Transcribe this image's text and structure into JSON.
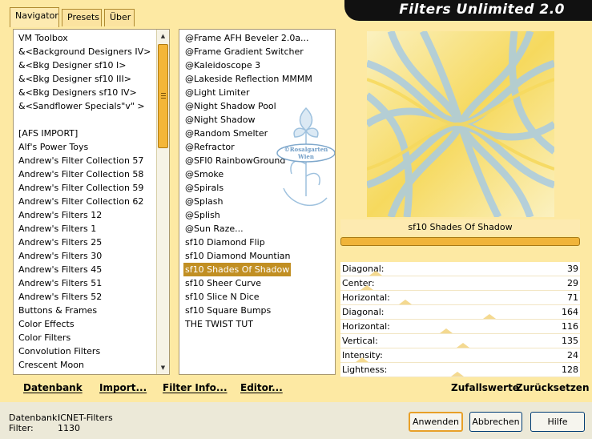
{
  "app_title": "Filters Unlimited 2.0",
  "tabs": [
    "Navigator",
    "Presets",
    "Über"
  ],
  "categories": {
    "selected_index": 1,
    "items": [
      "VM Toolbox",
      "&<Background Designers IV>",
      "&<Bkg Designer sf10 I>",
      "&<Bkg Designer sf10 III>",
      "&<Bkg Designers sf10 IV>",
      "&<Sandflower Specials\"v\" >",
      "",
      "[AFS IMPORT]",
      "Alf's Power Toys",
      "Andrew's Filter Collection 57",
      "Andrew's Filter Collection 58",
      "Andrew's Filter Collection 59",
      "Andrew's Filter Collection 62",
      "Andrew's Filters 12",
      "Andrew's Filters 1",
      "Andrew's Filters 25",
      "Andrew's Filters 30",
      "Andrew's Filters 45",
      "Andrew's Filters 51",
      "Andrew's Filters 52",
      "Buttons & Frames",
      "Color Effects",
      "Color Filters",
      "Convolution Filters",
      "Crescent Moon"
    ]
  },
  "filters": {
    "selected_index": 17,
    "items": [
      "@Frame AFH Beveler 2.0a...",
      "@Frame Gradient Switcher",
      "@Kaleidoscope 3",
      "@Lakeside Reflection MMMM",
      "@Light Limiter",
      "@Night Shadow Pool",
      "@Night Shadow",
      "@Random Smelter",
      "@Refractor",
      "@SFI0 RainbowGround",
      "@Smoke",
      "@Spirals",
      "@Splash",
      "@Splish",
      "@Sun Raze...",
      "sf10 Diamond Flip",
      "sf10 Diamond Mountian",
      "sf10 Shades Of Shadow",
      "sf10 Sheer Curve",
      "sf10 Slice N Dice",
      "sf10 Square Bumps",
      "THE TWIST TUT"
    ]
  },
  "watermark": "©Rosalgarten Wien",
  "preview": {
    "filter_name": "sf10 Shades Of Shadow",
    "colors": {
      "yellow": "#f6d95e",
      "blue": "#a9cbe2",
      "pale": "#fbf1c0"
    }
  },
  "parameters": [
    {
      "label": "Diagonal:",
      "value": "39",
      "level": 0.153
    },
    {
      "label": "Center:",
      "value": "29",
      "level": 0.114
    },
    {
      "label": "Horizontal:",
      "value": "71",
      "level": 0.278
    },
    {
      "label": "Diagonal:",
      "value": "164",
      "level": 0.643
    },
    {
      "label": "Horizontal:",
      "value": "116",
      "level": 0.455
    },
    {
      "label": "Vertical:",
      "value": "135",
      "level": 0.529
    },
    {
      "label": "Intensity:",
      "value": "24",
      "level": 0.094
    },
    {
      "label": "Lightness:",
      "value": "128",
      "level": 0.502
    }
  ],
  "bottom_links": {
    "datenbank": "Datenbank",
    "import": "Import...",
    "filter_info": "Filter Info...",
    "editor": "Editor...",
    "zufallswerte": "Zufallswerte",
    "zuruecksetzen": "Zurücksetzen"
  },
  "status": {
    "db_label": "Datenbank:",
    "db_value": "ICNET-Filters",
    "filter_label": "Filter:",
    "filter_value": "1130"
  },
  "buttons": {
    "apply": "Anwenden",
    "cancel": "Abbrechen",
    "help": "Hilfe"
  }
}
